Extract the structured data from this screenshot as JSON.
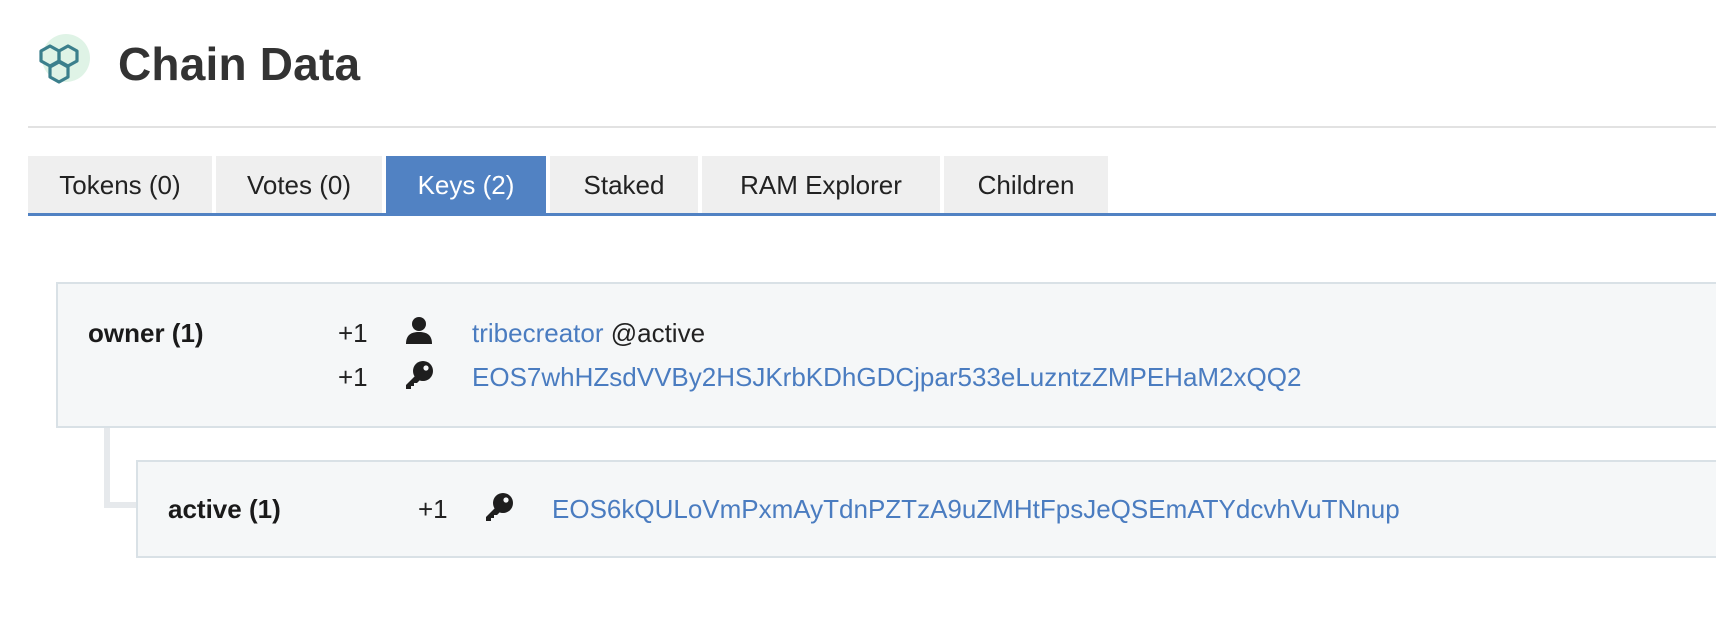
{
  "header": {
    "title": "Chain Data",
    "logo_icon": "hexagon-cluster-logo"
  },
  "tabs": [
    {
      "label": "Tokens (0)",
      "active": false
    },
    {
      "label": "Votes (0)",
      "active": false
    },
    {
      "label": "Keys (2)",
      "active": true
    },
    {
      "label": "Staked",
      "active": false
    },
    {
      "label": "RAM Explorer",
      "active": false
    },
    {
      "label": "Children",
      "active": false
    }
  ],
  "colors": {
    "accent": "#5182c3",
    "link": "#4a7cc0",
    "panel_bg": "#f5f7f8",
    "panel_border": "#d9e1e6"
  },
  "permissions": {
    "owner": {
      "name": "owner (1)",
      "entries": [
        {
          "weight": "+1",
          "icon": "user-icon",
          "account": "tribecreator",
          "permission": "@active"
        },
        {
          "weight": "+1",
          "icon": "key-icon",
          "key": "EOS7whHZsdVVBy2HSJKrbKDhGDCjpar533eLuzntzZMPEHaM2xQQ2"
        }
      ]
    },
    "active": {
      "name": "active (1)",
      "entries": [
        {
          "weight": "+1",
          "icon": "key-icon",
          "key": "EOS6kQULoVmPxmAyTdnPZTzA9uZMHtFpsJeQSEmATYdcvhVuTNnup"
        }
      ]
    }
  }
}
